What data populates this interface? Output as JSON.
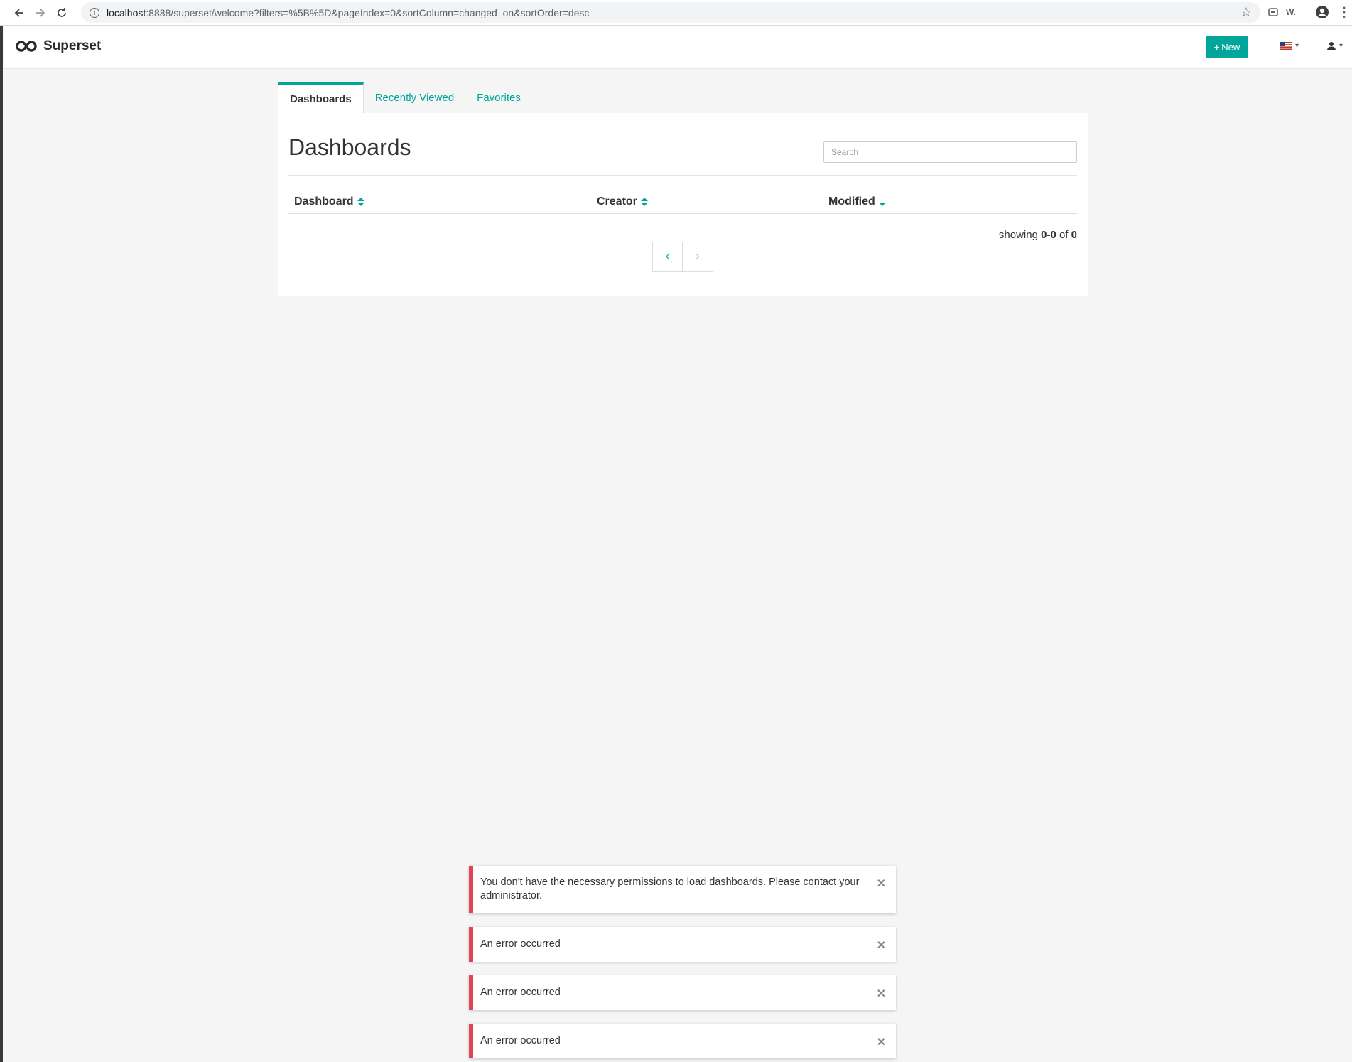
{
  "browser": {
    "url_host": "localhost",
    "url_rest": ":8888/superset/welcome?filters=%5B%5D&pageIndex=0&sortColumn=changed_on&sortOrder=desc",
    "w_ext_label": "W."
  },
  "header": {
    "brand": "Superset",
    "new_button": "New"
  },
  "tabs": [
    {
      "label": "Dashboards",
      "active": true
    },
    {
      "label": "Recently Viewed",
      "active": false
    },
    {
      "label": "Favorites",
      "active": false
    }
  ],
  "panel": {
    "title": "Dashboards",
    "search_placeholder": "Search",
    "columns": [
      {
        "label": "Dashboard",
        "sort": "both"
      },
      {
        "label": "Creator",
        "sort": "both"
      },
      {
        "label": "Modified",
        "sort": "desc"
      }
    ],
    "showing_prefix": "showing ",
    "showing_range": "0-0",
    "showing_of": " of ",
    "showing_total": "0",
    "pager_prev": "‹",
    "pager_next": "›"
  },
  "toasts": [
    {
      "text": "You don't have the necessary permissions to load dashboards. Please contact your administrator."
    },
    {
      "text": "An error occurred"
    },
    {
      "text": "An error occurred"
    },
    {
      "text": "An error occurred"
    }
  ],
  "colors": {
    "accent": "#00a699",
    "error": "#e04355"
  }
}
